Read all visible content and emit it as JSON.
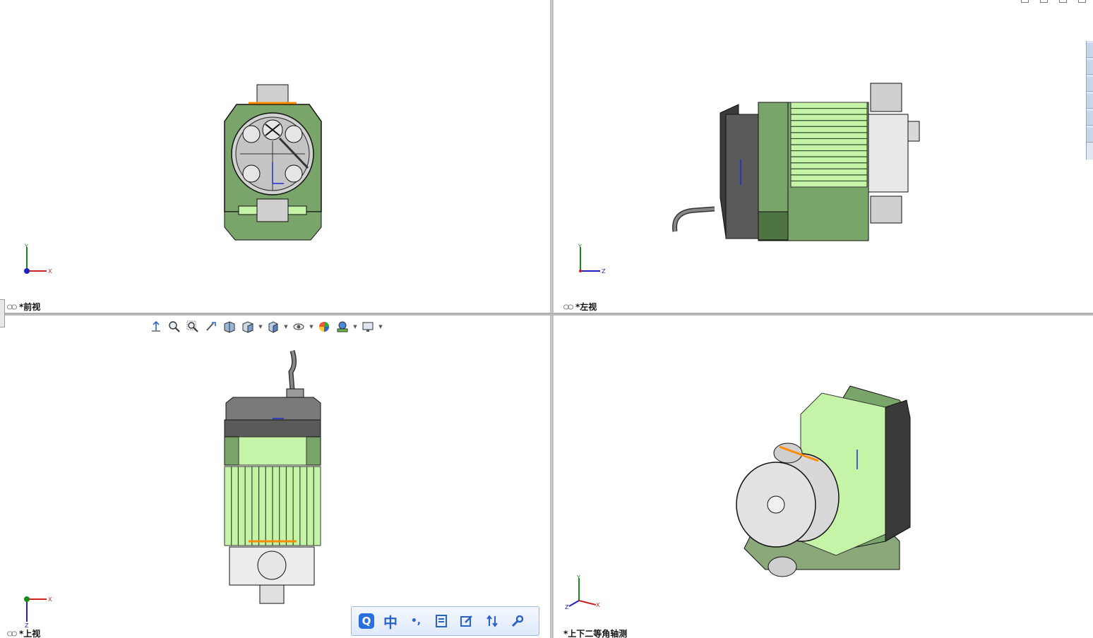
{
  "viewports": {
    "front": {
      "label": "*前视",
      "triad": {
        "up": "Y",
        "right": "X"
      }
    },
    "left": {
      "label": "*左视",
      "triad": {
        "up": "Y",
        "right": "Z"
      }
    },
    "top": {
      "label": "*上视",
      "triad": {
        "up": "X",
        "down": "Z"
      }
    },
    "iso": {
      "label": "*上下二等角轴测",
      "triad": {
        "up": "Y",
        "right": "X",
        "left": "Z"
      }
    }
  },
  "heads_up_toolbar": {
    "buttons": [
      "view-orientation-icon",
      "zoom-to-fit-icon",
      "zoom-to-area-icon",
      "previous-view-icon",
      "section-view-icon",
      "view-orientation-cube-icon",
      "display-style-icon",
      "hide-show-items-icon",
      "edit-appearance-icon",
      "apply-scene-icon",
      "view-settings-icon"
    ]
  },
  "ime_toolbar": {
    "items": [
      {
        "name": "ime-logo-icon",
        "text": "Q"
      },
      {
        "name": "chinese-mode-button",
        "text": "中"
      },
      {
        "name": "punctuation-button",
        "text": "•,"
      },
      {
        "name": "keyboard-icon",
        "text": ""
      },
      {
        "name": "handwriting-icon",
        "text": ""
      },
      {
        "name": "toolbox-icon",
        "text": ""
      },
      {
        "name": "settings-icon",
        "text": ""
      }
    ]
  },
  "colors": {
    "body_green": "#7aa56a",
    "light_green": "#c5f3a8",
    "dark_green": "#4f7444",
    "dark_gray": "#555555",
    "pump_gray": "#c8c8c8",
    "highlight_orange": "#ff8c00",
    "axis_x": "#d02020",
    "axis_y": "#1a8a1a",
    "axis_z": "#2020c0"
  }
}
